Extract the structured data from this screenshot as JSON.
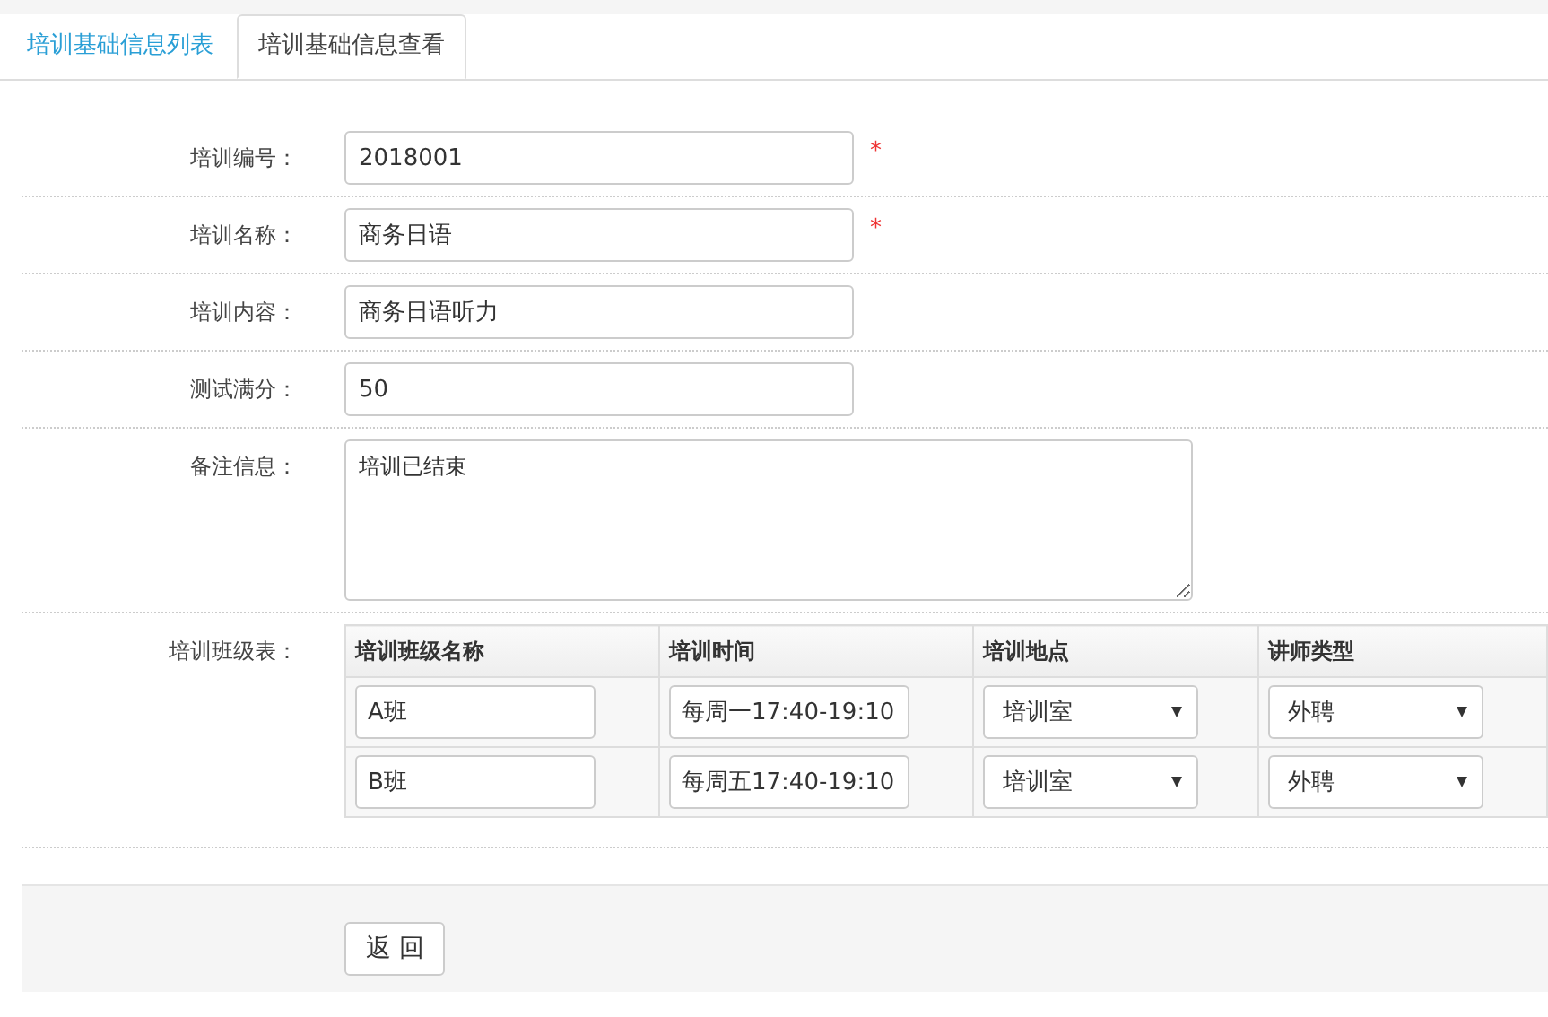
{
  "tabs": [
    {
      "label": "培训基础信息列表",
      "selected": false
    },
    {
      "label": "培训基础信息查看",
      "selected": true
    }
  ],
  "fields": [
    {
      "label": "培训编号：",
      "kind": "text",
      "value": "2018001",
      "required_mark": "*"
    },
    {
      "label": "培训名称：",
      "kind": "text",
      "value": "商务日语",
      "required_mark": "*"
    },
    {
      "label": "培训内容：",
      "kind": "text",
      "value": "商务日语听力"
    },
    {
      "label": "测试满分：",
      "kind": "text",
      "value": "50"
    },
    {
      "label": "备注信息：",
      "kind": "textarea",
      "value": "培训已结束"
    }
  ],
  "class_table": {
    "label": "培训班级表：",
    "columns": [
      "培训班级名称",
      "培训时间",
      "培训地点",
      "讲师类型"
    ],
    "rows": [
      {
        "cells": [
          {
            "kind": "text",
            "value": "A班"
          },
          {
            "kind": "text",
            "value": "每周一17:40-19:10"
          },
          {
            "kind": "select",
            "value": "培训室"
          },
          {
            "kind": "select",
            "value": "外聘"
          }
        ]
      },
      {
        "cells": [
          {
            "kind": "text",
            "value": "B班"
          },
          {
            "kind": "text",
            "value": "每周五17:40-19:10"
          },
          {
            "kind": "select",
            "value": "培训室"
          },
          {
            "kind": "select",
            "value": "外聘"
          }
        ]
      }
    ]
  },
  "buttons": [
    {
      "label": "返 回"
    }
  ]
}
